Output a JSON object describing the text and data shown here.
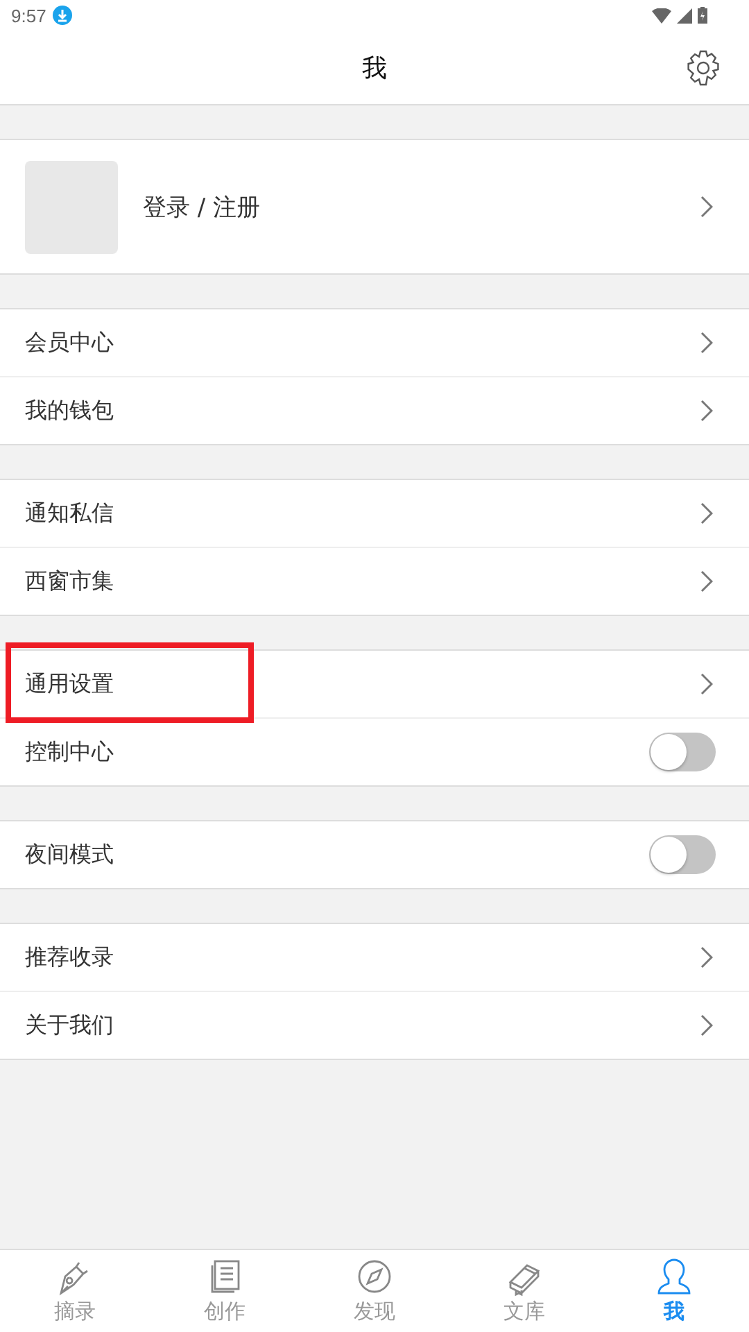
{
  "status_bar": {
    "time": "9:57"
  },
  "header": {
    "title": "我"
  },
  "profile": {
    "label": "登录 / 注册"
  },
  "groups": [
    {
      "rows": [
        {
          "kind": "link",
          "label": "会员中心",
          "highlighted": false
        },
        {
          "kind": "link",
          "label": "我的钱包",
          "highlighted": false
        }
      ]
    },
    {
      "rows": [
        {
          "kind": "link",
          "label": "通知私信",
          "highlighted": false
        },
        {
          "kind": "link",
          "label": "西窗市集",
          "highlighted": false
        }
      ]
    },
    {
      "rows": [
        {
          "kind": "link",
          "label": "通用设置",
          "highlighted": true
        },
        {
          "kind": "toggle",
          "label": "控制中心",
          "on": false,
          "highlighted": false
        }
      ]
    },
    {
      "rows": [
        {
          "kind": "toggle",
          "label": "夜间模式",
          "on": false,
          "highlighted": false
        }
      ]
    },
    {
      "rows": [
        {
          "kind": "link",
          "label": "推荐收录",
          "highlighted": false
        },
        {
          "kind": "link",
          "label": "关于我们",
          "highlighted": false
        }
      ]
    }
  ],
  "tabs": [
    {
      "label": "摘录",
      "selected": false
    },
    {
      "label": "创作",
      "selected": false
    },
    {
      "label": "发现",
      "selected": false
    },
    {
      "label": "文库",
      "selected": false
    },
    {
      "label": "我",
      "selected": true
    }
  ]
}
